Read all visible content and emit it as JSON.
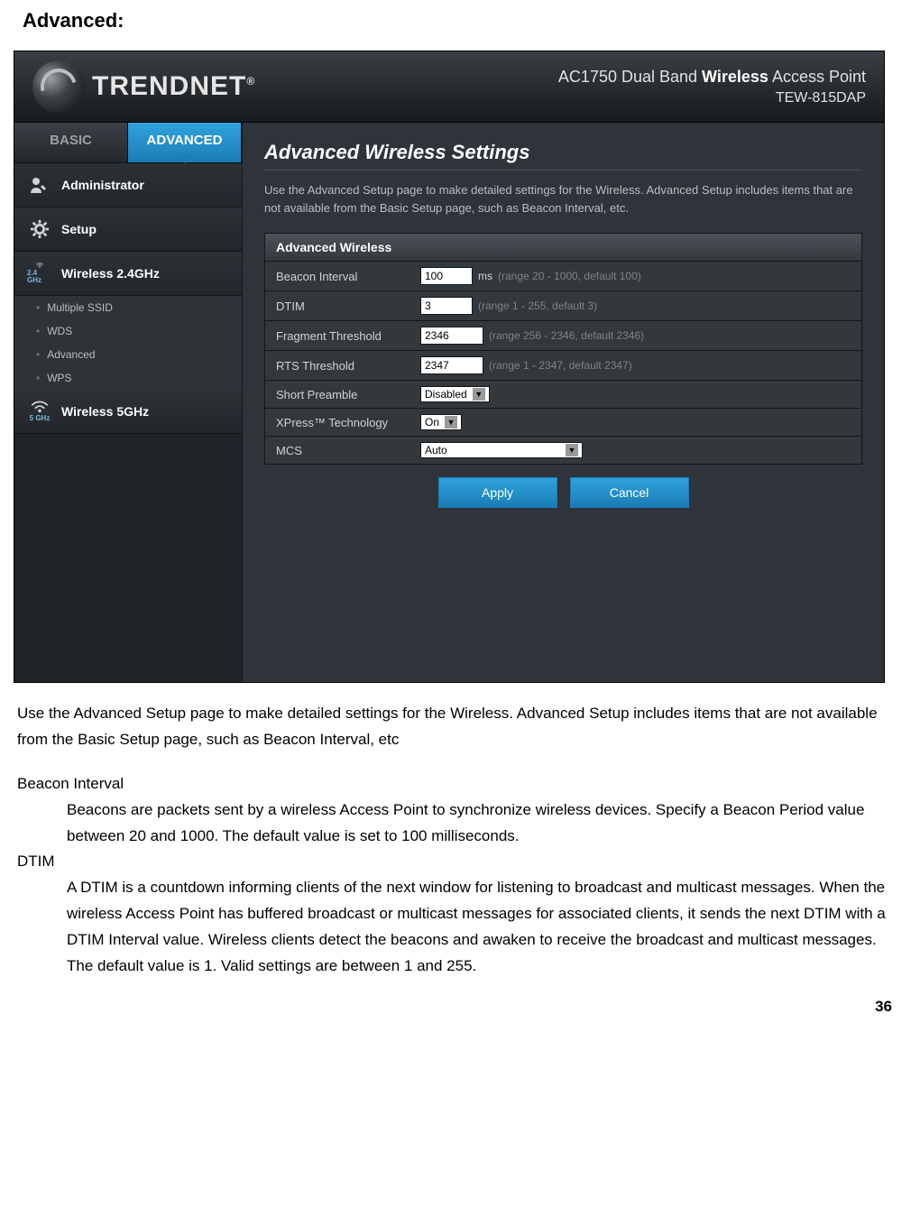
{
  "section_title": "Advanced:",
  "header": {
    "logo_text": "TRENDNET",
    "product_prefix": "AC1750 Dual Band",
    "product_wireless": "Wireless",
    "product_suffix": " Access Point",
    "model": "TEW-815DAP"
  },
  "tabs": {
    "basic": "BASIC",
    "advanced": "ADVANCED"
  },
  "sidebar": {
    "administrator": "Administrator",
    "setup": "Setup",
    "wireless24": "Wireless 2.4GHz",
    "wireless24_band": "2.4 GHz",
    "sub": [
      "Multiple SSID",
      "WDS",
      "Advanced",
      "WPS"
    ],
    "wireless5": "Wireless 5GHz",
    "wireless5_band": "5 GHz"
  },
  "main": {
    "title": "Advanced Wireless Settings",
    "intro": "Use the Advanced Setup page to make detailed settings for the Wireless. Advanced Setup includes items that are not available from the Basic Setup page, such as Beacon Interval, etc.",
    "box_title": "Advanced Wireless",
    "rows": {
      "beacon": {
        "label": "Beacon Interval",
        "value": "100",
        "unit": "ms",
        "hint": "(range 20 - 1000, default 100)"
      },
      "dtim": {
        "label": "DTIM",
        "value": "3",
        "hint": "(range 1 - 255, default 3)"
      },
      "fragment": {
        "label": "Fragment Threshold",
        "value": "2346",
        "hint": "(range 256 - 2346, default 2346)"
      },
      "rts": {
        "label": "RTS Threshold",
        "value": "2347",
        "hint": "(range 1 - 2347, default 2347)"
      },
      "preamble": {
        "label": "Short Preamble",
        "value": "Disabled"
      },
      "xpress": {
        "label": "XPress™ Technology",
        "value": "On"
      },
      "mcs": {
        "label": "MCS",
        "value": "Auto"
      }
    },
    "buttons": {
      "apply": "Apply",
      "cancel": "Cancel"
    }
  },
  "doc": {
    "intro": "Use the Advanced Setup page to make detailed settings for the Wireless. Advanced Setup includes items that are not available from the Basic Setup page, such as Beacon Interval, etc",
    "beacon_term": "Beacon Interval",
    "beacon_def": "Beacons are packets sent by a wireless Access Point to synchronize wireless devices. Specify a Beacon Period value between 20 and 1000. The default value is set to 100 milliseconds.",
    "dtim_term": "DTIM",
    "dtim_def": "A DTIM is a countdown informing clients of the next window for listening to broadcast and multicast messages. When the wireless Access Point has buffered broadcast or multicast messages for associated clients, it sends the next DTIM with a DTIM Interval value. Wireless clients detect the beacons and awaken to receive the broadcast and multicast messages. The default value is 1. Valid settings are between 1 and 255."
  },
  "page_number": "36"
}
